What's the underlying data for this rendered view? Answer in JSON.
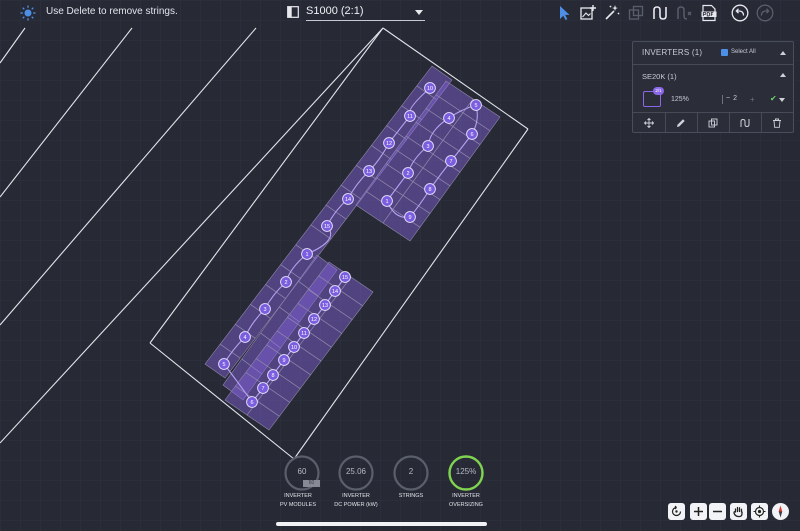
{
  "topbar": {
    "hint": "Use Delete to remove strings.",
    "design": "S1000 (2:1)",
    "tools": [
      "select-icon",
      "add-image-icon",
      "magic-wand-icon",
      "copy-icon",
      "string-icon",
      "string-disabled-icon",
      "pdf-icon",
      "undo-icon",
      "redo-icon"
    ]
  },
  "panel": {
    "title": "INVERTERS (1)",
    "select_all": "Select All",
    "inverter": {
      "name": "SE20K (1)",
      "badge": "2/1",
      "oversizing": "125%",
      "strings": "2"
    },
    "actions": [
      "move-icon",
      "edit-icon",
      "duplicate-icon",
      "string-icon",
      "trash-icon"
    ]
  },
  "stats": [
    {
      "value": "60",
      "sub": "60",
      "label1": "INVERTER",
      "label2": "PV MODULES"
    },
    {
      "value": "25.06",
      "label1": "INVERTER",
      "label2": "DC POWER (kW)"
    },
    {
      "value": "2",
      "label1": "STRINGS",
      "label2": ""
    },
    {
      "value": "125%",
      "label1": "INVERTER",
      "label2": "OVERSIZING",
      "fill": 1.0
    }
  ],
  "strings_layout": {
    "upper_a_labels": [
      "15",
      "14",
      "13",
      "12",
      "11",
      "10"
    ],
    "upper_b_labels": [
      "1",
      "2",
      "3",
      "4",
      "5",
      "6",
      "7",
      "8",
      "9"
    ],
    "lower_a_labels": [
      "1",
      "2",
      "3",
      "4",
      "5"
    ],
    "lower_b_labels": [
      "6",
      "7",
      "8",
      "9",
      "10",
      "11",
      "12",
      "13",
      "14",
      "15"
    ]
  },
  "colors": {
    "accent": "#8a67e8",
    "ok": "#6fd36a",
    "gauge_ok": "#7fd34e"
  }
}
